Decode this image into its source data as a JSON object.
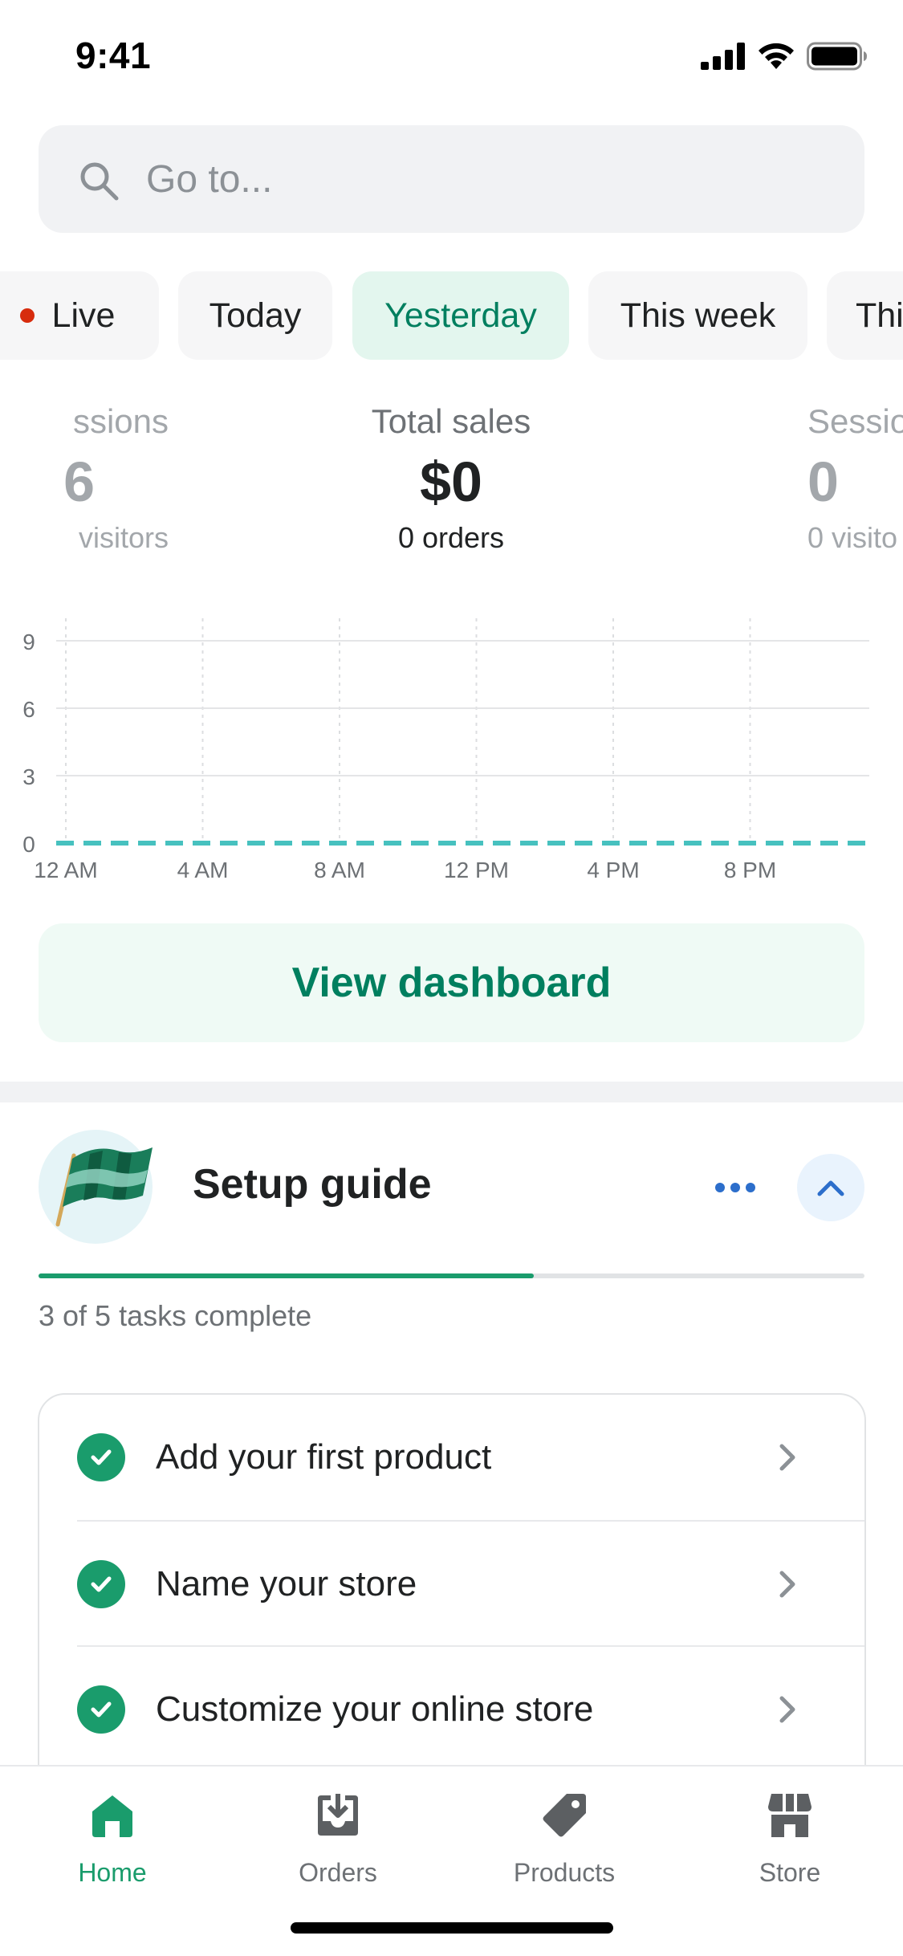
{
  "status_bar": {
    "time": "9:41"
  },
  "search": {
    "placeholder": "Go to..."
  },
  "date_filters": [
    {
      "label": "Live",
      "live": true,
      "selected": false
    },
    {
      "label": "Today",
      "selected": false
    },
    {
      "label": "Yesterday",
      "selected": true
    },
    {
      "label": "This week",
      "selected": false
    },
    {
      "label": "Thi",
      "selected": false
    }
  ],
  "metrics": {
    "left": {
      "label": "ssions",
      "value": "6",
      "sub": "visitors"
    },
    "center": {
      "label": "Total sales",
      "value": "$0",
      "sub": "0 orders"
    },
    "right": {
      "label": "Sessio",
      "value": "0",
      "sub": "0 visito"
    }
  },
  "chart_data": {
    "type": "line",
    "x": [
      "12 AM",
      "4 AM",
      "8 AM",
      "12 PM",
      "4 PM",
      "8 PM"
    ],
    "y_ticks": [
      0,
      3,
      6,
      9
    ],
    "ylim": [
      0,
      9
    ],
    "series": [
      {
        "values": [
          0,
          0,
          0,
          0,
          0,
          0
        ],
        "color": "#47c1bf",
        "style": "dashed"
      }
    ],
    "grid": true
  },
  "dashboard_button": {
    "label": "View dashboard"
  },
  "setup_guide": {
    "title": "Setup guide",
    "progress_text": "3 of 5 tasks complete",
    "progress_fraction": 0.6,
    "tasks": [
      {
        "label": "Add your first product",
        "done": true
      },
      {
        "label": "Name your store",
        "done": true
      },
      {
        "label": "Customize your online store",
        "done": true
      }
    ]
  },
  "tab_bar": {
    "tabs": [
      {
        "label": "Home",
        "icon": "home-icon",
        "active": true
      },
      {
        "label": "Orders",
        "icon": "orders-icon",
        "active": false
      },
      {
        "label": "Products",
        "icon": "tag-icon",
        "active": false
      },
      {
        "label": "Store",
        "icon": "store-icon",
        "active": false
      }
    ]
  },
  "colors": {
    "accent": "#1a9c6c",
    "accent_text": "#007f5f",
    "chart_line": "#47c1bf",
    "link_blue": "#2c6ecb",
    "live_red": "#d72c0d"
  }
}
